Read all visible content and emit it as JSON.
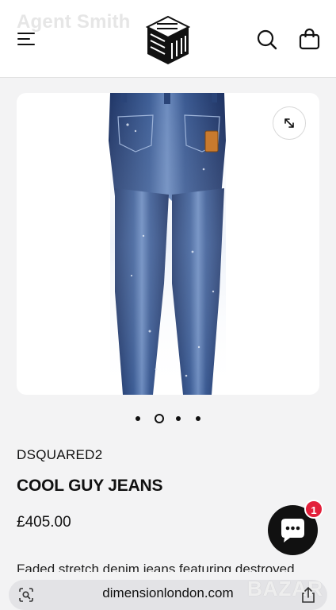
{
  "header": {
    "ghost_title": "Agent Smith",
    "menu_icon": "hamburger-menu-icon",
    "logo_icon": "brand-cube-logo",
    "search_icon": "search-icon",
    "bag_icon": "shopping-bag-icon"
  },
  "gallery": {
    "image": "product-photo-jeans-back",
    "expand_icon": "expand-arrows-icon",
    "slides": 4,
    "active_slide": 2
  },
  "product": {
    "brand": "DSQUARED2",
    "name": "COOL GUY JEANS",
    "price": "£405.00",
    "description": "Faded stretch denim jeans featuring destroyed"
  },
  "chat": {
    "icon": "chat-bubble-icon",
    "badge": "1",
    "color": "#111111",
    "badge_color": "#e3203b"
  },
  "browser": {
    "url": "dimensionlondon.com",
    "lens_icon": "visual-search-icon",
    "share_icon": "share-icon",
    "watermark": "BAZAR"
  }
}
